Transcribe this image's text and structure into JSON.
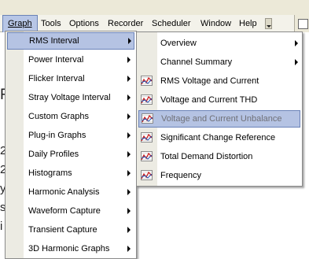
{
  "menubar": {
    "items": [
      "Graph",
      "Tools",
      "Options",
      "Recorder",
      "Scheduler",
      "Window",
      "Help"
    ]
  },
  "background_text": [
    "R",
    "2",
    "2",
    "y",
    "s",
    "i"
  ],
  "graph_menu": {
    "items": [
      {
        "label": "RMS Interval",
        "submenu": true,
        "highlighted": true
      },
      {
        "label": "Power Interval",
        "submenu": true
      },
      {
        "label": "Flicker Interval",
        "submenu": true
      },
      {
        "label": "Stray Voltage Interval",
        "submenu": true
      },
      {
        "label": "Custom Graphs",
        "submenu": true
      },
      {
        "label": "Plug-in Graphs",
        "submenu": true
      },
      {
        "label": "Daily Profiles",
        "submenu": true
      },
      {
        "label": "Histograms",
        "submenu": true
      },
      {
        "label": "Harmonic Analysis",
        "submenu": true
      },
      {
        "label": "Waveform Capture",
        "submenu": true
      },
      {
        "label": "Transient Capture",
        "submenu": true
      },
      {
        "label": "3D Harmonic Graphs",
        "submenu": true
      }
    ]
  },
  "rms_submenu": {
    "items": [
      {
        "label": "Overview",
        "submenu": true,
        "icon": null
      },
      {
        "label": "Channel Summary",
        "submenu": true,
        "icon": null
      },
      {
        "label": "RMS Voltage and Current",
        "icon": "chart-icon"
      },
      {
        "label": "Voltage and Current THD",
        "icon": "chart-icon"
      },
      {
        "label": "Voltage and Current Unbalance",
        "icon": "chart-icon",
        "selected": true
      },
      {
        "label": "Significant Change Reference",
        "icon": "chart-icon"
      },
      {
        "label": "Total Demand Distortion",
        "icon": "chart-icon"
      },
      {
        "label": "Frequency",
        "icon": "chart-icon"
      }
    ]
  },
  "colors": {
    "menu_highlight": "#b5c3e3",
    "menu_highlight_border": "#6a82b8",
    "menubar_bg": "#f3f2ea",
    "gutter": "#ecebe3",
    "chart_line": "#cc2020"
  }
}
